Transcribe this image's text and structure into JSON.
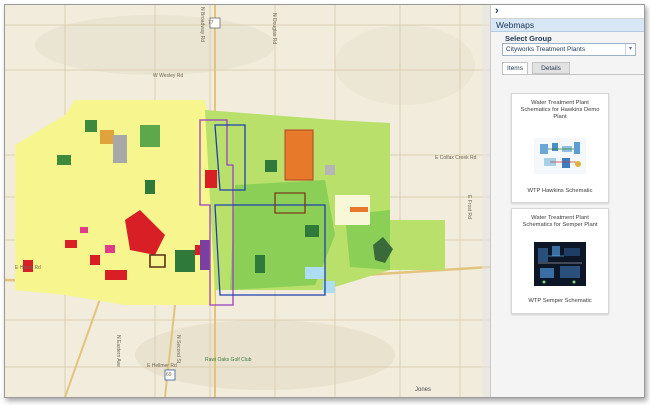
{
  "panel": {
    "title": "Webmaps",
    "select_group_label": "Select Group",
    "selected_group": "Cityworks Treatment Plants",
    "tabs": [
      {
        "label": "Items",
        "active": true
      },
      {
        "label": "Details",
        "active": false
      }
    ],
    "items": [
      {
        "title": "Water Treatment Plant Schematics for Hawkins Demo Plant",
        "caption": "WTP Hawkins Schematic"
      },
      {
        "title": "Water Treatment Plant Schematics for Semper Plant",
        "caption": "WTP Semper Schematic"
      }
    ],
    "collapse_icon": "chevron-right-icon"
  },
  "map": {
    "labels": {
      "road_n_broadway": "N Broadway Rd",
      "road_n_douglas": "N Douglas Rd",
      "road_w_wesley": "W Wesley Rd",
      "road_colfax": "E Colfax Creek Rd",
      "road_hellmer": "E Hellmer Rd",
      "road_n_eastern": "N Eastern Ave",
      "road_n_second": "N Second St",
      "road_e_frost": "E Frost Rd",
      "road_e_harris": "E Harris Rd",
      "golf": "Rawi Oaks Golf Club",
      "town": "Jones"
    },
    "route_shields": [
      "77",
      "69"
    ],
    "colors": {
      "base": "#f1ecdc",
      "residential": "#f7f58d",
      "park": "#8ccf56",
      "agricultural": "#b8e06a",
      "commercial": "#d91f26",
      "industrial": "#7b3fa0",
      "water": "#aedcf0",
      "boundary_blue": "#1f3fb0",
      "boundary_purple": "#9b3fc0"
    }
  }
}
